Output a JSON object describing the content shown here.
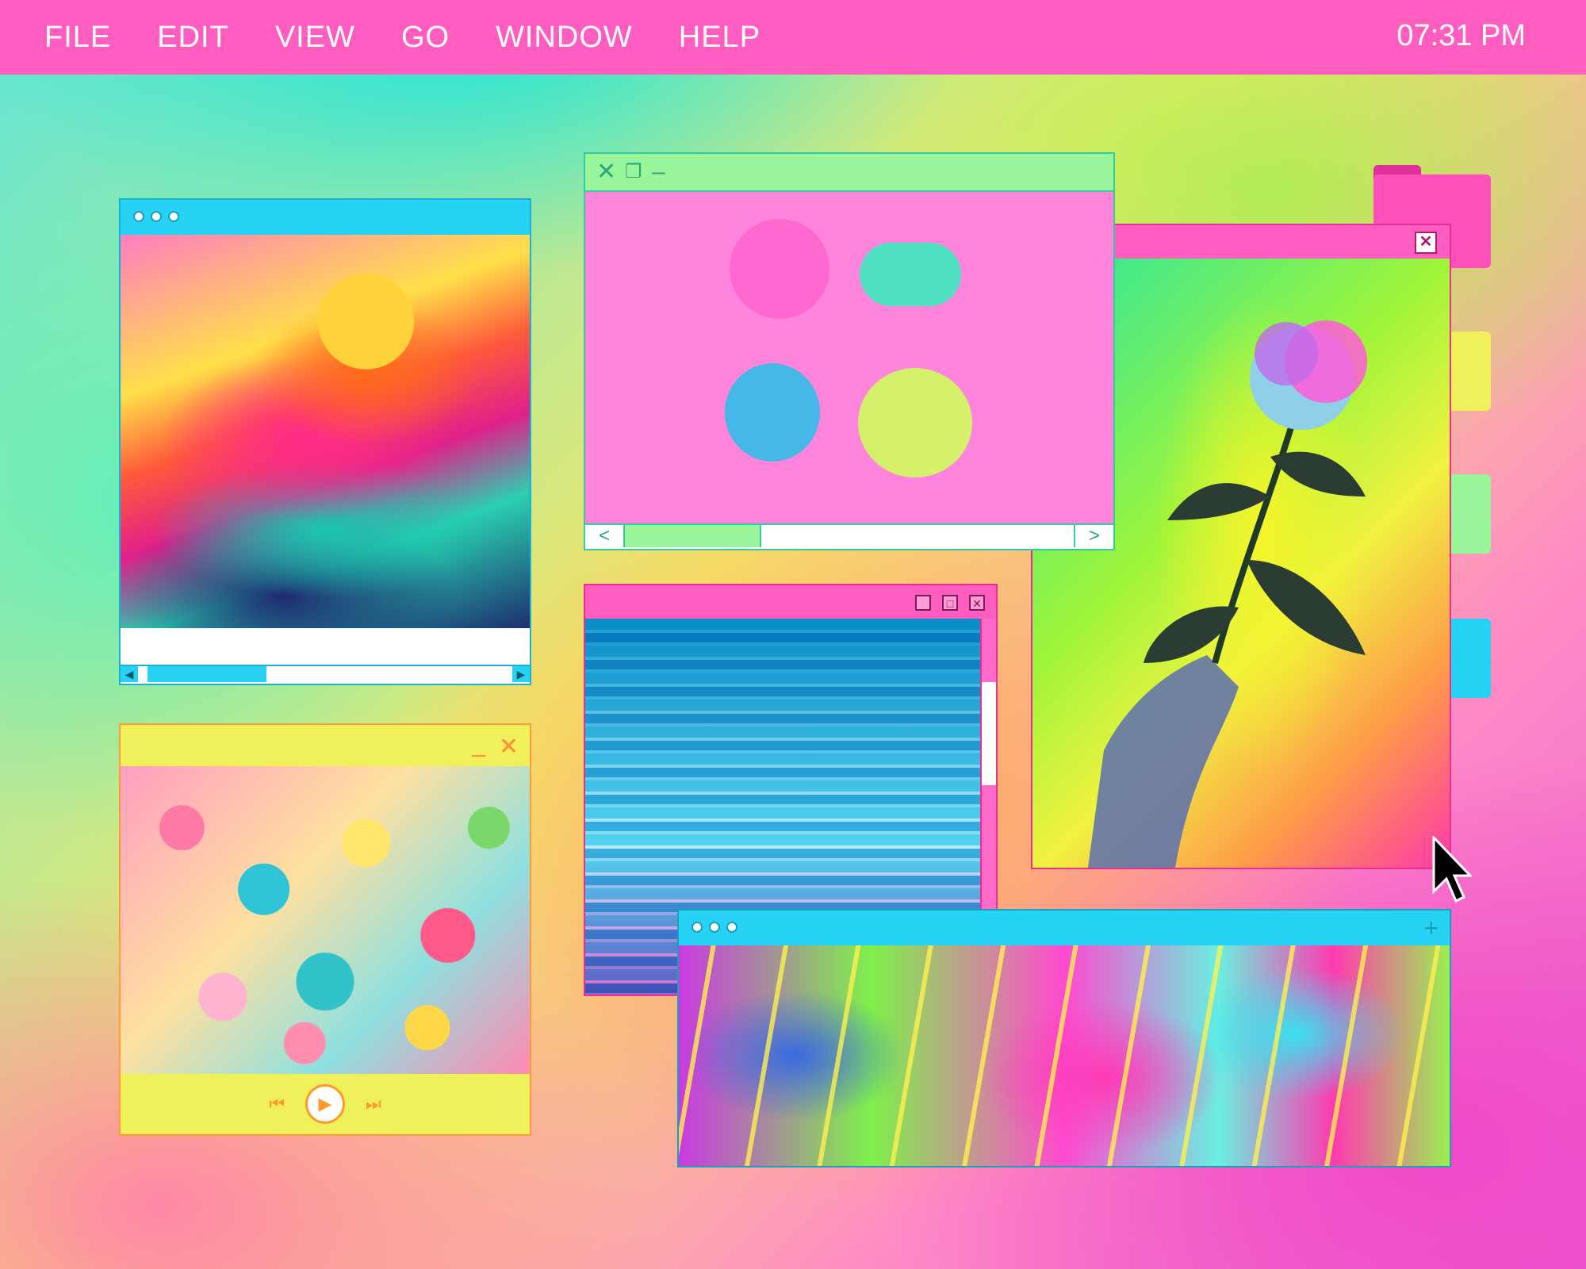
{
  "menubar": {
    "items": [
      "FILE",
      "EDIT",
      "VIEW",
      "GO",
      "WINDOW",
      "HELP"
    ],
    "clock": "07:31 PM"
  },
  "colors": {
    "menubar": "#ff5ec0",
    "cyan": "#27d3f4",
    "mint": "#98f59a",
    "pink": "#ff5ec0",
    "yellow": "#f0f05a"
  },
  "windows": {
    "painting": {
      "icon": "abstract-painting"
    },
    "macarons": {
      "icon": "macarons-photo",
      "scroll_left": "<",
      "scroll_right": ">"
    },
    "rose": {
      "icon": "rose-photo",
      "close": "✕"
    },
    "glitch": {
      "icon": "glitch-photo",
      "minimize": "_",
      "maximize": "□",
      "close": "✕"
    },
    "cereal": {
      "icon": "cereal-photo",
      "minimize": "_",
      "close": "✕"
    },
    "swirl": {
      "icon": "swirl-art",
      "add": "+"
    }
  }
}
